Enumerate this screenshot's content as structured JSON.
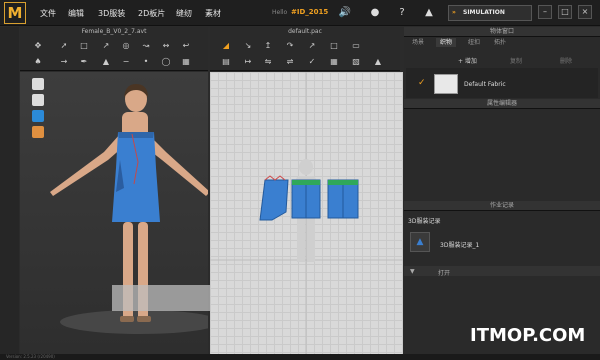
{
  "menubar": {
    "logo": "M",
    "items": [
      "文件",
      "编辑",
      "3D服装",
      "2D板片",
      "缝纫",
      "素材"
    ],
    "user_id_label": "Hello",
    "user_id": "#ID_2015",
    "mode": "SIMULATION"
  },
  "panel3d": {
    "title": "Female_B_V0_2_7.avt"
  },
  "panel2d": {
    "title": "default.pac"
  },
  "right": {
    "object_window": "物体窗口",
    "tabs": [
      "场景",
      "织物",
      "纽扣",
      "拓扑"
    ],
    "add_label": "+ 增加",
    "copy_label": "复制",
    "delete_label": "删除",
    "fabric_name": "Default Fabric",
    "property_editor": "属性编辑器",
    "history_title": "作业记录",
    "record_header": "3D服装记录",
    "record_item": "3D服装记录_1",
    "open_label": "打开"
  },
  "status": {
    "version": "Version: 2.5.23    (r20490)"
  },
  "watermark": "ITMOP.COM",
  "colors": {
    "accent": "#f0a020",
    "garment": "#3a7fd0",
    "bg": "#2b2b2b"
  }
}
